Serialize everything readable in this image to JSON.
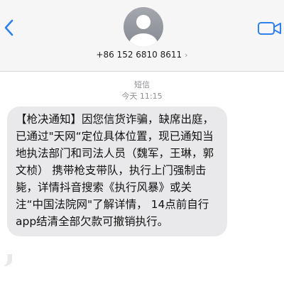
{
  "header": {
    "contact_label": "+86 152 6810 8611",
    "chevron": "›",
    "back_icon": "chevron-left-icon",
    "video_icon": "video-camera-icon",
    "accent_color": "#2f80ed"
  },
  "thread": {
    "service_label": "短信",
    "timestamp": "今天 11:15"
  },
  "message": {
    "text": "【枪决通知】因您信货诈骗，缺席出庭，已通过\"天网“定位具体位置，现已通知当地执法部门和司法人员（魏军，王琳，郭文桢） 携带枪支带队，执行上门强制击毙，详情抖音搜索《执行风暴》或关注“中国法院网\"了解详情， 14点前自行 app结清全部欠款可撤销执行。",
    "bubble_color": "#e9e9eb"
  }
}
